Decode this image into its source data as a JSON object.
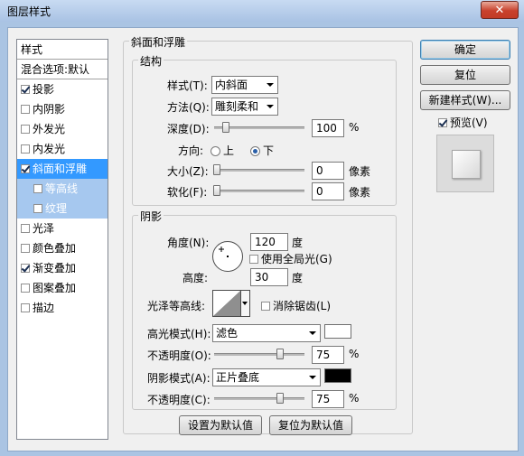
{
  "window": {
    "title": "图层样式",
    "close_glyph": "✕"
  },
  "sidebar": {
    "header": "样式",
    "blend_options": "混合选项:默认",
    "items": [
      {
        "label": "投影",
        "checked": true
      },
      {
        "label": "内阴影",
        "checked": false
      },
      {
        "label": "外发光",
        "checked": false
      },
      {
        "label": "内发光",
        "checked": false
      },
      {
        "label": "斜面和浮雕",
        "checked": true,
        "selected": true
      },
      {
        "label": "等高线",
        "checked": false,
        "sub": true
      },
      {
        "label": "纹理",
        "checked": false,
        "sub": true
      },
      {
        "label": "光泽",
        "checked": false
      },
      {
        "label": "颜色叠加",
        "checked": false
      },
      {
        "label": "渐变叠加",
        "checked": true
      },
      {
        "label": "图案叠加",
        "checked": false
      },
      {
        "label": "描边",
        "checked": false
      }
    ]
  },
  "bevel": {
    "title": "斜面和浮雕",
    "structure": {
      "title": "结构",
      "style_label": "样式(T):",
      "style_value": "内斜面",
      "technique_label": "方法(Q):",
      "technique_value": "雕刻柔和",
      "depth_label": "深度(D):",
      "depth_value": "100",
      "depth_unit": "%",
      "depth_fraction": 0.1,
      "direction_label": "方向:",
      "direction_up": "上",
      "direction_down": "下",
      "direction_selected": "down",
      "size_label": "大小(Z):",
      "size_value": "0",
      "size_unit": "像素",
      "soften_label": "软化(F):",
      "soften_value": "0",
      "soften_unit": "像素"
    },
    "shading": {
      "title": "阴影",
      "angle_label": "角度(N):",
      "angle_value": "120",
      "angle_unit": "度",
      "global_light_label": "使用全局光(G)",
      "global_light_checked": false,
      "altitude_label": "高度:",
      "altitude_value": "30",
      "altitude_unit": "度",
      "gloss_label": "光泽等高线:",
      "antialias_label": "消除锯齿(L)",
      "antialias_checked": false,
      "highlight_mode_label": "高光模式(H):",
      "highlight_mode_value": "滤色",
      "highlight_color": "#ffffff",
      "highlight_opacity_label": "不透明度(O):",
      "highlight_opacity_value": "75",
      "highlight_opacity_unit": "%",
      "highlight_opacity_fraction": 0.75,
      "shadow_mode_label": "阴影模式(A):",
      "shadow_mode_value": "正片叠底",
      "shadow_color": "#000000",
      "shadow_opacity_label": "不透明度(C):",
      "shadow_opacity_value": "75",
      "shadow_opacity_unit": "%",
      "shadow_opacity_fraction": 0.75
    },
    "make_default": "设置为默认值",
    "reset_default": "复位为默认值"
  },
  "buttons": {
    "ok": "确定",
    "reset": "复位",
    "new_style": "新建样式(W)...",
    "preview_label": "预览(V)",
    "preview_checked": true
  }
}
